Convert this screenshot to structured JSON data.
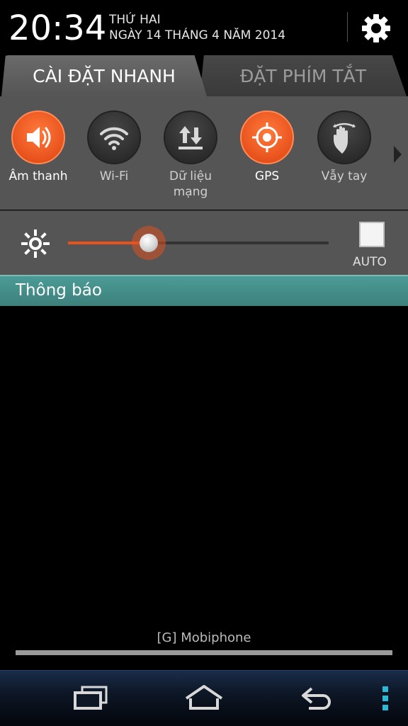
{
  "header": {
    "time": "20:34",
    "day": "THỨ HAI",
    "date": "NGÀY 14 THÁNG 4 NĂM 2014",
    "settings_icon": "gear-icon"
  },
  "tabs": [
    {
      "label": "CÀI ĐẶT NHANH",
      "selected": true
    },
    {
      "label": "ĐẶT PHÍM TẮT",
      "selected": false
    }
  ],
  "toggles": [
    {
      "label": "Âm thanh",
      "state": "on",
      "icon": "speaker-icon"
    },
    {
      "label": "Wi-Fi",
      "state": "off",
      "icon": "wifi-icon"
    },
    {
      "label": "Dữ liệu mạng",
      "state": "off",
      "icon": "data-arrows-icon"
    },
    {
      "label": "GPS",
      "state": "on",
      "icon": "gps-target-icon"
    },
    {
      "label": "Vẫy tay",
      "state": "off",
      "icon": "wave-hand-icon"
    }
  ],
  "brightness": {
    "level": 0.31,
    "auto_label": "AUTO",
    "auto_checked": false
  },
  "notifications": {
    "title": "Thông báo"
  },
  "carrier": "[G] Mobiphone",
  "colors": {
    "accent": "#e8521c",
    "notif_header": "#3e807c",
    "panel": "#555555"
  }
}
